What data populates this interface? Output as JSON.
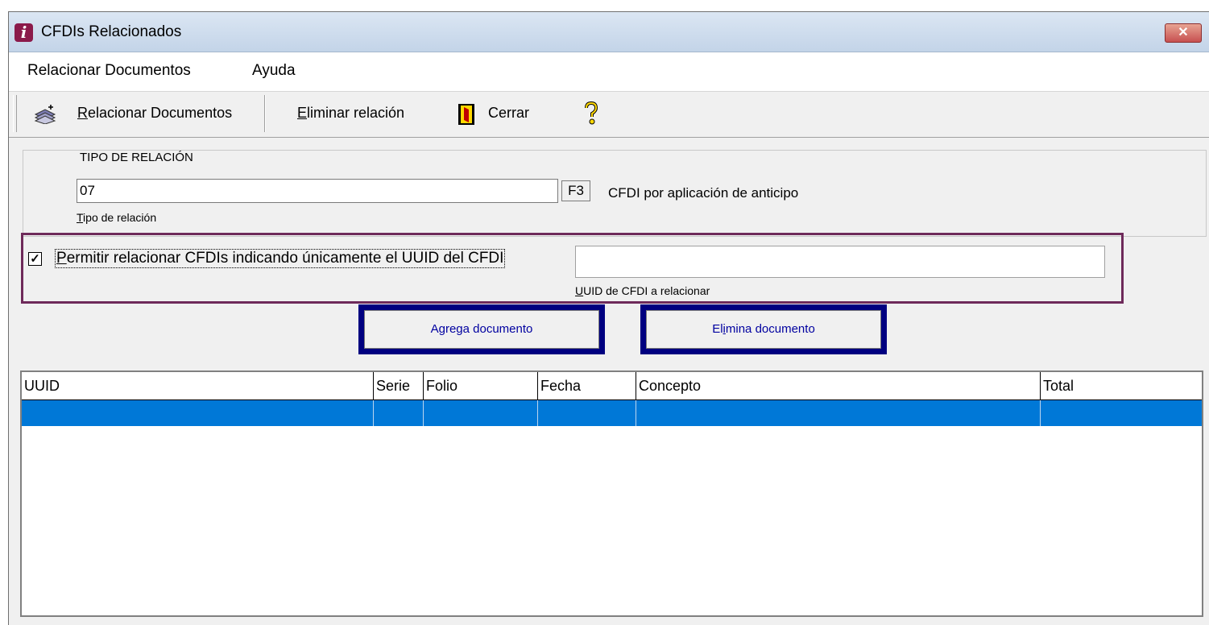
{
  "window": {
    "title": "CFDIs Relacionados",
    "icon": "info-icon",
    "close_label": "✕"
  },
  "menubar": {
    "items": [
      "Relacionar Documentos",
      "Ayuda"
    ]
  },
  "toolbar": {
    "relacionar": {
      "label_first": "R",
      "label_rest": "elacionar Documentos",
      "icon": "books-icon"
    },
    "eliminar": {
      "label_first": "E",
      "label_rest": "liminar relación"
    },
    "cerrar": {
      "label": "Cerrar",
      "icon": "exit-door-icon"
    },
    "help": {
      "icon": "help-icon"
    }
  },
  "tipo_relacion": {
    "group_title": "TIPO DE RELACIÓN",
    "value": "07",
    "f3_label": "F3",
    "description": "CFDI por aplicación de anticipo",
    "field_label_first": "T",
    "field_label_rest": "ipo de relación"
  },
  "uuid_section": {
    "checkbox_checked": true,
    "checkbox_label_first": "P",
    "checkbox_label_rest": "ermitir relacionar CFDIs indicando únicamente el UUID del CFDI",
    "uuid_value": "",
    "uuid_label_first": "U",
    "uuid_label_rest": "UID de CFDI a relacionar"
  },
  "buttons": {
    "agrega": "Agrega documento",
    "elimina_first": "El",
    "elimina_u": "i",
    "elimina_rest": "mina documento"
  },
  "grid": {
    "columns": [
      "UUID",
      "Serie",
      "Folio",
      "Fecha",
      "Concepto",
      "Total"
    ],
    "rows": [
      [
        "",
        "",
        "",
        "",
        "",
        ""
      ]
    ],
    "selected_row_color": "#0078d7"
  }
}
